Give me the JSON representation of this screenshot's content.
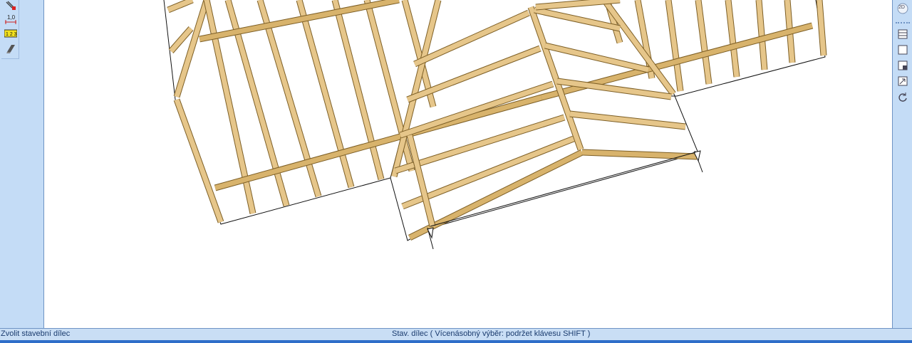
{
  "status_bar": {
    "left_text": "Zvolit stavební dílec",
    "center_text": "Stav. dílec (  Vícenásobný výběr: podržet klávesu SHIFT )"
  },
  "left_toolbar": {
    "tools": [
      {
        "icon": "cut-tool-icon"
      },
      {
        "icon": "dimension-icon",
        "label": "1,0"
      },
      {
        "icon": "numbering-icon",
        "label": "1 2 3"
      },
      {
        "icon": "beam-profile-icon"
      }
    ]
  },
  "right_toolbar": {
    "view_toggle_label": "2D",
    "tools": [
      {
        "icon": "layers-icon"
      },
      {
        "icon": "frame-icon"
      },
      {
        "icon": "window-icon"
      },
      {
        "icon": "zoom-fit-icon"
      },
      {
        "icon": "rotate-icon"
      }
    ]
  },
  "colors": {
    "panel": "#c4dcf6",
    "timber_face": "#e8c98d",
    "timber_edge": "#8a6a2f",
    "status_bar": "#c9def5",
    "accent_bar": "#2e6ec9"
  }
}
